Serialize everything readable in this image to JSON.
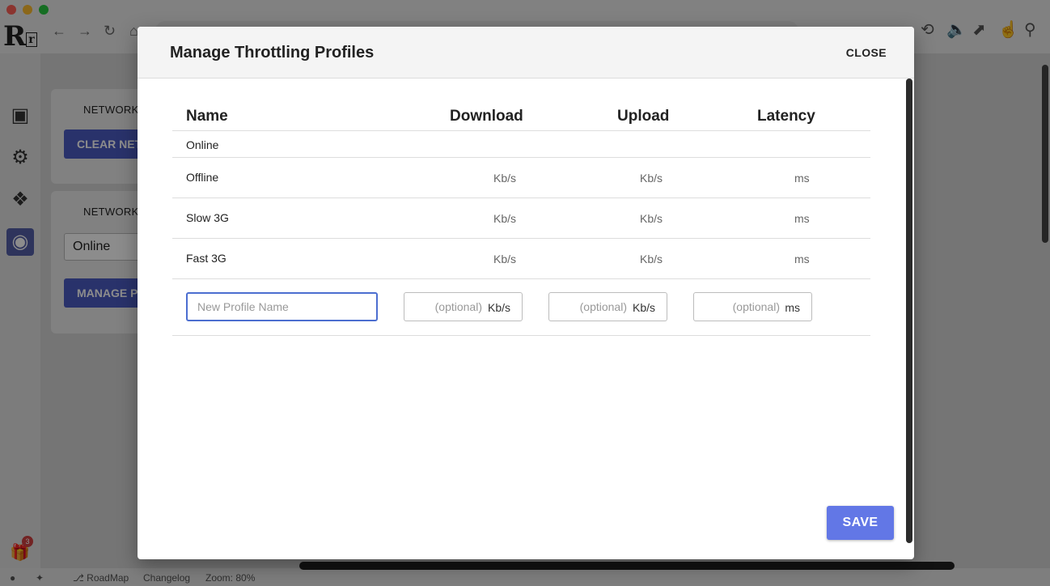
{
  "background": {
    "card1_title": "NETWORK",
    "card1_button": "CLEAR NET",
    "card2_title": "NETWORK",
    "card2_select_value": "Online",
    "card2_button": "MANAGE P",
    "gift_badge": "3",
    "status": {
      "roadmap": "RoadMap",
      "changelog": "Changelog",
      "zoom": "Zoom: 80%"
    }
  },
  "modal": {
    "title": "Manage Throttling Profiles",
    "close_label": "CLOSE",
    "columns": {
      "name": "Name",
      "download": "Download",
      "upload": "Upload",
      "latency": "Latency"
    },
    "rows": [
      {
        "name": "Online",
        "download_unit": "",
        "upload_unit": "",
        "latency_unit": ""
      },
      {
        "name": "Offline",
        "download_unit": "Kb/s",
        "upload_unit": "Kb/s",
        "latency_unit": "ms"
      },
      {
        "name": "Slow 3G",
        "download_unit": "Kb/s",
        "upload_unit": "Kb/s",
        "latency_unit": "ms"
      },
      {
        "name": "Fast 3G",
        "download_unit": "Kb/s",
        "upload_unit": "Kb/s",
        "latency_unit": "ms"
      }
    ],
    "new_profile": {
      "name_placeholder": "New Profile Name",
      "download_placeholder": "(optional)",
      "download_unit": "Kb/s",
      "upload_placeholder": "(optional)",
      "upload_unit": "Kb/s",
      "latency_placeholder": "(optional)",
      "latency_unit": "ms"
    },
    "save_label": "SAVE"
  },
  "colors": {
    "primary": "#6277e6",
    "background_primary": "#4c5bc4",
    "focus_border": "#4c6ed0"
  }
}
